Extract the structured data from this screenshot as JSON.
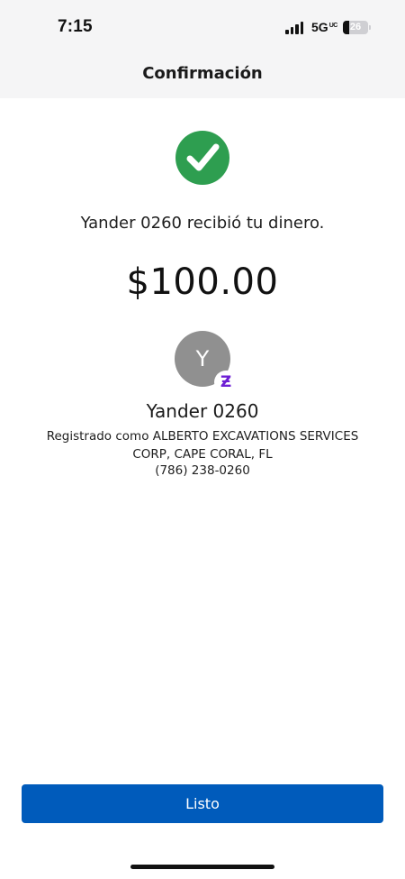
{
  "status_bar": {
    "time": "7:15",
    "network": "5G",
    "network_sup": "UC",
    "battery_level": "26",
    "battery_fraction": 0.26,
    "signal_bars": 4
  },
  "header": {
    "title": "Confirmación"
  },
  "confirmation": {
    "icon": "checkmark-circle-icon",
    "icon_color": "#2e9e50",
    "message": "Yander 0260 recibió tu dinero.",
    "amount": "$100.00"
  },
  "recipient": {
    "avatar_initial": "Y",
    "badge_icon": "zelle-icon",
    "badge_glyph": "Ƶ",
    "badge_color": "#6d1ed4",
    "name": "Yander 0260",
    "registered_line1": "Registrado como ALBERTO EXCAVATIONS SERVICES",
    "registered_line2": "CORP, CAPE CORAL, FL",
    "phone": "(786) 238-0260"
  },
  "actions": {
    "done_label": "Listo",
    "accent_color": "#005bbb"
  }
}
